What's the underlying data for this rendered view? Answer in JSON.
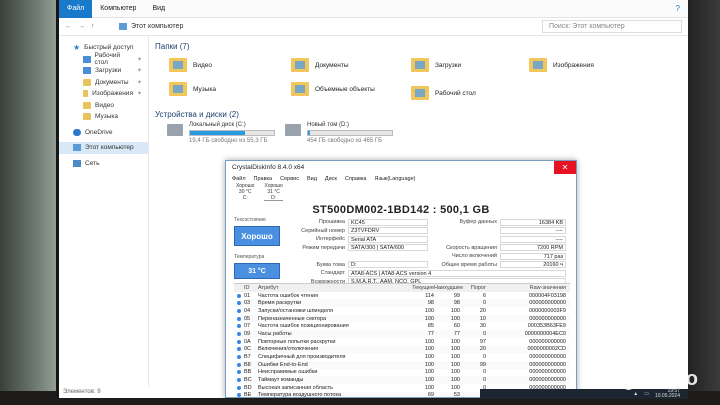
{
  "explorer": {
    "ribbon_tabs": [
      "Файл",
      "Компьютер",
      "Вид"
    ],
    "breadcrumb": "Этот компьютер",
    "search_placeholder": "Поиск: Этот компьютер",
    "sidebar": [
      {
        "label": "Быстрый доступ",
        "icon": "star-icon",
        "sub": false,
        "pinned": false
      },
      {
        "label": "Рабочий стол",
        "icon": "folder-icon",
        "sub": true,
        "pinned": true
      },
      {
        "label": "Загрузки",
        "icon": "download-icon",
        "sub": true,
        "pinned": true
      },
      {
        "label": "Документы",
        "icon": "folder-icon",
        "sub": true,
        "pinned": true
      },
      {
        "label": "Изображения",
        "icon": "folder-icon",
        "sub": true,
        "pinned": true
      },
      {
        "label": "Видео",
        "icon": "folder-icon",
        "sub": true,
        "pinned": false
      },
      {
        "label": "Музыка",
        "icon": "folder-icon",
        "sub": true,
        "pinned": false
      },
      {
        "label": "OneDrive",
        "icon": "cloud-icon",
        "sub": false,
        "pinned": false
      },
      {
        "label": "Этот компьютер",
        "icon": "computer-icon",
        "sub": false,
        "pinned": false,
        "selected": true
      },
      {
        "label": "Сеть",
        "icon": "network-icon",
        "sub": false,
        "pinned": false
      }
    ],
    "folders_title": "Папки (7)",
    "folders": [
      "Видео",
      "Документы",
      "Загрузки",
      "Изображения",
      "Музыка",
      "Объемные объекты",
      "Рабочий стол"
    ],
    "drives_title": "Устройства и диски (2)",
    "drives": [
      {
        "name": "Локальный диск (C:)",
        "free": "19,4 ГБ свободно из 55,3 ГБ",
        "used_fraction": 0.65
      },
      {
        "name": "Новый том (D:)",
        "free": "454 ГБ свободно из 465 ГБ",
        "used_fraction": 0.02
      }
    ],
    "status": "Элементов: 9"
  },
  "cdi": {
    "title": "CrystalDiskInfo 8.4.0 x64",
    "menu": [
      "Файл",
      "Правка",
      "Сервис",
      "Вид",
      "Диск",
      "Справка",
      "Язык(Language)"
    ],
    "drive_tabs": [
      {
        "status": "Хорошо",
        "temp": "30 °C",
        "letter": "C:"
      },
      {
        "status": "Хорошо",
        "temp": "31 °C",
        "letter": "D:"
      }
    ],
    "model": "ST500DM002-1BD142 : 500,1 GB",
    "health_label": "Техсостояние",
    "health_value": "Хорошо",
    "temp_label": "Температура",
    "temp_value": "31 °C",
    "info": [
      {
        "k1": "Прошивка",
        "v1": "KC45",
        "k2": "Буфер данных",
        "v2": "16384 KB"
      },
      {
        "k1": "Серийный номер",
        "v1": "Z3TVFDRV",
        "k2": "",
        "v2": "----"
      },
      {
        "k1": "Интерфейс",
        "v1": "Serial ATA",
        "k2": "",
        "v2": "----"
      },
      {
        "k1": "Режим передачи",
        "v1": "SATA/300 | SATA/600",
        "k2": "Скорость вращения",
        "v2": "7200 RPM"
      },
      {
        "k1": "",
        "v1": "",
        "k2": "Число включений",
        "v2": "717 раз"
      },
      {
        "k1": "Буква тома",
        "v1": "D:",
        "k2": "Общее время работы",
        "v2": "20160 ч"
      }
    ],
    "standard_label": "Стандарт",
    "standard_value": "ATA8-ACS | ATA8-ACS version 4",
    "features_label": "Возможности",
    "features_value": "S.M.A.R.T., AAM, NCQ, GPL",
    "smart_header": [
      "ID",
      "Атрибут",
      "Текущее",
      "Наихудшее",
      "Порог",
      "Raw-значения"
    ],
    "smart_rows": [
      [
        "01",
        "Частота ошибок чтения",
        "114",
        "99",
        "6",
        "000004F03198"
      ],
      [
        "03",
        "Время раскрутки",
        "98",
        "98",
        "0",
        "000000000000"
      ],
      [
        "04",
        "Запуски/остановки шпинделя",
        "100",
        "100",
        "20",
        "0000000003F9"
      ],
      [
        "05",
        "Переназначенные сектора",
        "100",
        "100",
        "10",
        "000000000000"
      ],
      [
        "07",
        "Частота ошибок позиционирования",
        "85",
        "60",
        "30",
        "000353B63FE9"
      ],
      [
        "09",
        "Часы работы",
        "77",
        "77",
        "0",
        "0000000004EC0"
      ],
      [
        "0A",
        "Повторные попытки раскрутки",
        "100",
        "100",
        "97",
        "000000000000"
      ],
      [
        "0C",
        "Включения/отключения",
        "100",
        "100",
        "20",
        "0000000002CD"
      ],
      [
        "B7",
        "Специфичный для производителя",
        "100",
        "100",
        "0",
        "000000000000"
      ],
      [
        "B8",
        "Ошибки End-to-End",
        "100",
        "100",
        "99",
        "000000000000"
      ],
      [
        "BB",
        "Неисправимые ошибки",
        "100",
        "100",
        "0",
        "000000000000"
      ],
      [
        "BC",
        "Таймаут команды",
        "100",
        "100",
        "0",
        "000000000000"
      ],
      [
        "BD",
        "Высокая записанная область",
        "100",
        "100",
        "0",
        "000000000000"
      ],
      [
        "BE",
        "Температура воздушного потока",
        "69",
        "53",
        "45",
        "00001F1C001F"
      ],
      [
        "C2",
        "Температура",
        "31",
        "47",
        "0",
        "00000000001F"
      ],
      [
        "C3",
        "Исправленные аппаратно ECC",
        "31",
        "5",
        "0",
        "000004F03198"
      ]
    ]
  },
  "taskbar": {
    "time": "19:57",
    "date": "10.05.2024"
  },
  "watermark": "Avito"
}
